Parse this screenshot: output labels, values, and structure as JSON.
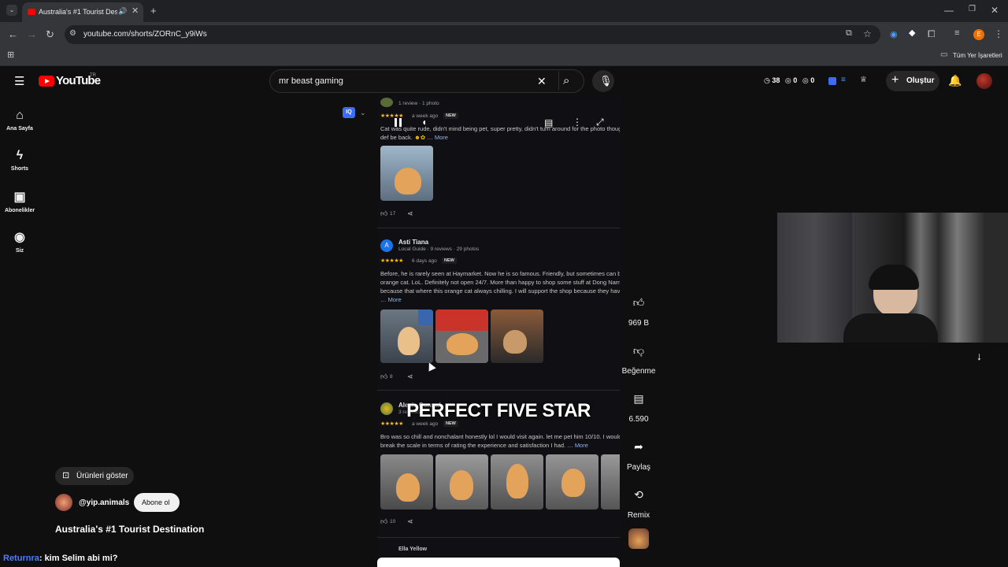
{
  "browser": {
    "tab_title": "Australia's #1 Tourist Destin",
    "url": "youtube.com/shorts/ZORnC_y9iWs",
    "bookmarks_label": "Tüm Yer İşaretleri",
    "profile_letter": "E"
  },
  "header": {
    "logo": "YouTube",
    "region": "TR",
    "search_value": "mr beast gaming",
    "counters": [
      "38",
      "0",
      "0"
    ],
    "create_label": "Oluştur"
  },
  "sidebar": {
    "items": [
      {
        "label": "Ana Sayfa",
        "icon": "home-icon"
      },
      {
        "label": "Shorts",
        "icon": "shorts-icon"
      },
      {
        "label": "Abonelikler",
        "icon": "subscriptions-icon"
      },
      {
        "label": "Siz",
        "icon": "you-icon"
      }
    ]
  },
  "short": {
    "reviews": [
      {
        "meta": "1 review · 1 photo",
        "age": "a week ago",
        "badge": "NEW",
        "text": "Cat was quite rude, didn't mind being pet, super pretty, didn't turn around for the photo though",
        "text2": "def be back.",
        "more": "More",
        "likes": "17"
      },
      {
        "author": "Asti Tiana",
        "avatar_letter": "A",
        "meta": "Local Guide · 9 reviews · 29 photos",
        "age": "6 days ago",
        "badge": "NEW",
        "lines": [
          "Before, he is rarely seen at Haymarket. Now he is so famous. Friendly, but sometimes can b",
          "orange cat. LoL. Definitely not open 24/7. More than happy to shop some stuff at Dong Nam",
          "because that where this orange cat always chilling. I will support the shop because they hav"
        ],
        "more": "More",
        "likes": "8"
      },
      {
        "author": "Alexis Conrad",
        "meta": "3 reviews",
        "age": "a week ago",
        "badge": "NEW",
        "lines": [
          "Bro was so chill and nonchalant honestly lol I would visit again. let me pet him 10/10. I would",
          "break the scale in terms of rating the experience and satisfaction I had."
        ],
        "more": "More",
        "likes": "10"
      },
      {
        "author": "Ella Yellow"
      }
    ],
    "caption": "PERFECT FIVE STAR"
  },
  "actions": {
    "like_count": "969 B",
    "dislike_label": "Beğenme",
    "comment_count": "6.590",
    "share_label": "Paylaş",
    "remix_label": "Remix"
  },
  "info": {
    "products_label": "Ürünleri göster",
    "channel": "@yip.animals",
    "subscribe_label": "Abone ol",
    "title": "Australia's #1 Tourist Destination"
  },
  "chat": {
    "user": "Returnra",
    "message": ": kim Selim abi mi?"
  },
  "colors": {
    "accent_red": "#ff0000",
    "chat_user": "#4d7bff",
    "stars": "#fbbc04"
  }
}
